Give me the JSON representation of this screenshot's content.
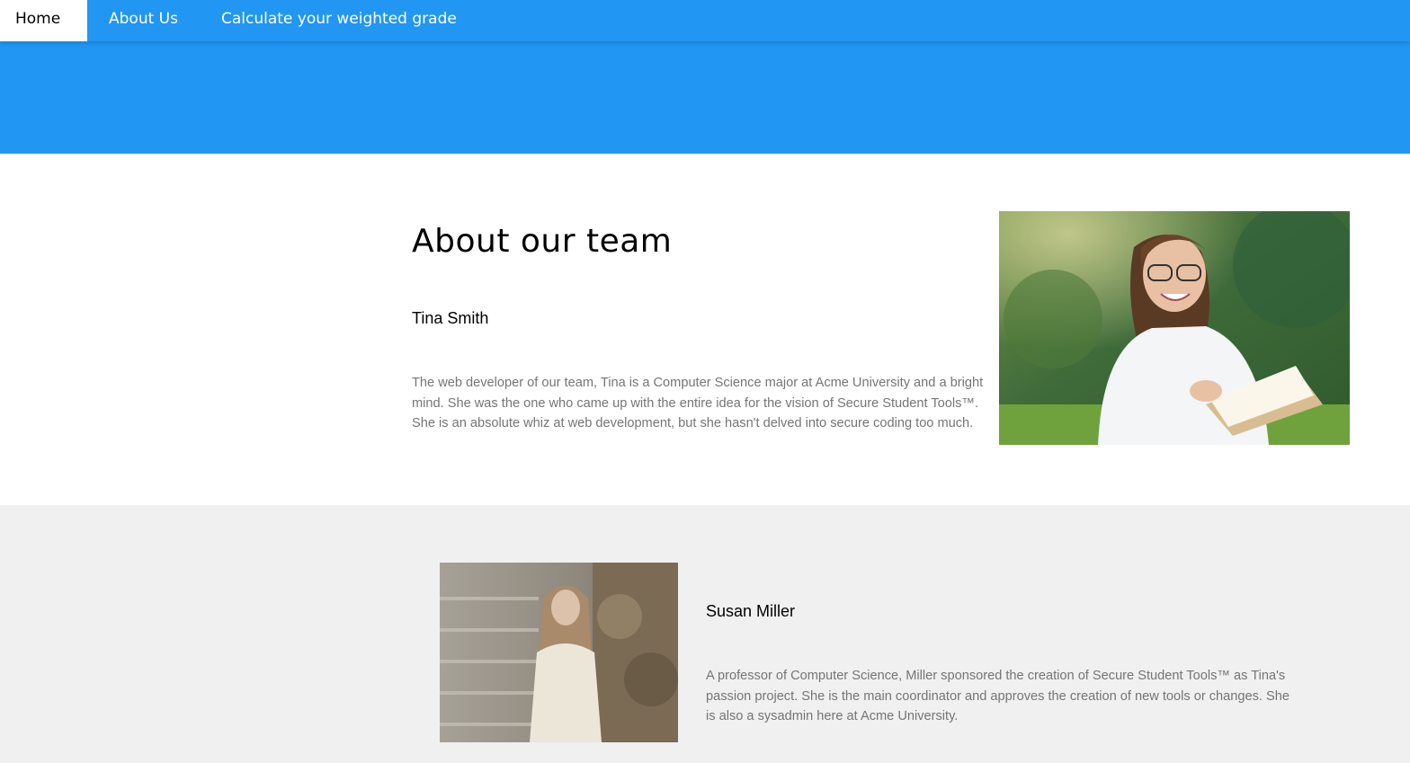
{
  "nav": {
    "items": [
      {
        "label": "Home",
        "active": true
      },
      {
        "label": "About Us",
        "active": false
      },
      {
        "label": "Calculate your weighted grade",
        "active": false
      }
    ]
  },
  "colors": {
    "brand_blue": "#2196f3",
    "muted_text": "#757575",
    "alt_section_bg": "#f0f0f0"
  },
  "about": {
    "heading": "About our team",
    "members": [
      {
        "name": "Tina Smith",
        "bio": "The web developer of our team, Tina is a Computer Science major at Acme University and a bright mind. She was the one who came up with the entire idea for the vision of Secure Student Tools™. She is an absolute whiz at web development, but she hasn't delved into secure coding too much."
      },
      {
        "name": "Susan Miller",
        "bio": "A professor of Computer Science, Miller sponsored the creation of Secure Student Tools™ as Tina's passion project. She is the main coordinator and approves the creation of new tools or changes. She is also a sysadmin here at Acme University."
      }
    ]
  }
}
